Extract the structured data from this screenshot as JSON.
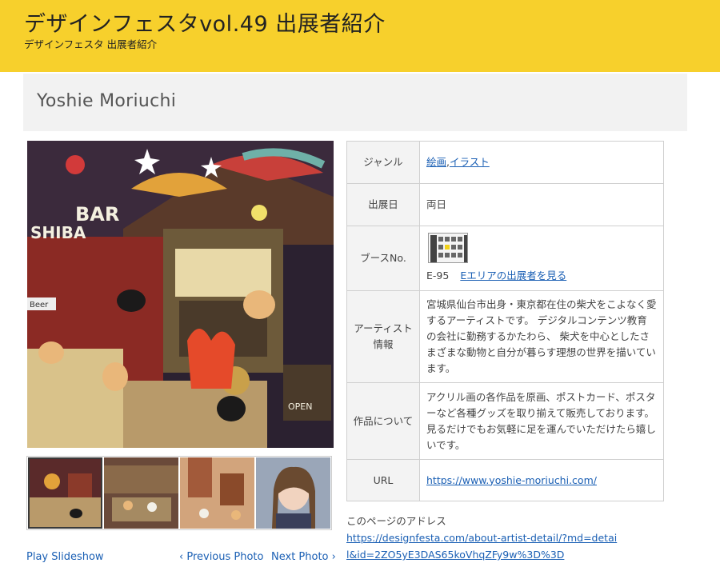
{
  "header": {
    "title": "デザインフェスタvol.49 出展者紹介",
    "subtitle": "デザインフェスタ 出展者紹介",
    "background": "#f7d02c"
  },
  "artist": {
    "name": "Yoshie Moriuchi"
  },
  "gallery": {
    "main_image_icon": "artwork-bar-shiba-image",
    "thumbnail_count": 4,
    "active_thumbnail": 1,
    "controls": {
      "play": "Play Slideshow",
      "prev": "‹ Previous Photo",
      "next": "Next Photo ›"
    }
  },
  "info_table": {
    "genre": {
      "label": "ジャンル",
      "links": [
        "絵画",
        "イラスト"
      ],
      "separator": ","
    },
    "date": {
      "label": "出展日",
      "value": "両日"
    },
    "booth": {
      "label": "ブースNo.",
      "number": "E-95",
      "area_link": "Eエリアの出展者を見る",
      "map_icon": "booth-map-image"
    },
    "artist_info": {
      "label": "アーティスト情報",
      "value": "宮城県仙台市出身・東京都在住の柴犬をこよなく愛するアーティストです。 デジタルコンテンツ教育の会社に勤務するかたわら、 柴犬を中心としたさまざまな動物と自分が暮らす理想の世界を描いています。"
    },
    "works": {
      "label": "作品について",
      "value": "アクリル画の各作品を原画、ポストカード、ポスターなど各種グッズを取り揃えて販売しております。見るだけでもお気軽に足を運んでいただけたら嬉しいです。"
    },
    "url": {
      "label": "URL",
      "value": "https://www.yoshie-moriuchi.com/"
    }
  },
  "page_address": {
    "label": "このページのアドレス",
    "url": "https://designfesta.com/about-artist-detail/?md=detail&id=2ZO5yE3DAS65koVhqZFy9w%3D%3D"
  },
  "colors": {
    "link": "#1a5fb4",
    "label_bg": "#f3f3f3",
    "name_bar_bg": "#f2f2f2"
  }
}
